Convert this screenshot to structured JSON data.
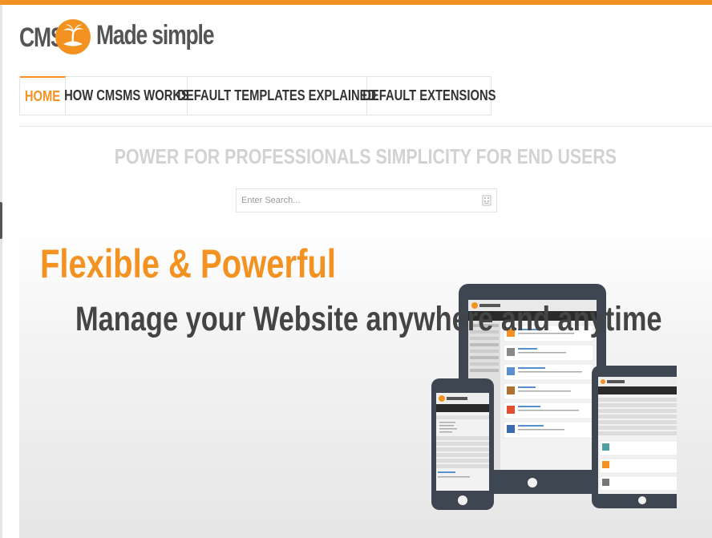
{
  "logo": {
    "left_text": "CMS",
    "right_text": "Made simple",
    "accent_color": "#f39220"
  },
  "nav": {
    "items": [
      {
        "label": "HOME",
        "active": true
      },
      {
        "label": "HOW CMSMS WORKS",
        "active": false
      },
      {
        "label": "DEFAULT TEMPLATES EXPLAINED",
        "active": false
      },
      {
        "label": "DEFAULT EXTENSIONS",
        "active": false
      }
    ]
  },
  "tagline": "POWER FOR PROFESSIONALS SIMPLICITY FOR END USERS",
  "search": {
    "placeholder": "Enter Search...",
    "value": "",
    "icon": "search-icon"
  },
  "hero": {
    "title": "Flexible & Powerful",
    "subtitle": "Manage your Website anywhere and anytime",
    "image": "devices-illustration"
  },
  "colors": {
    "accent": "#f39220",
    "nav_text": "#333333",
    "tagline": "#d2d2d2",
    "subtitle": "#444444"
  }
}
